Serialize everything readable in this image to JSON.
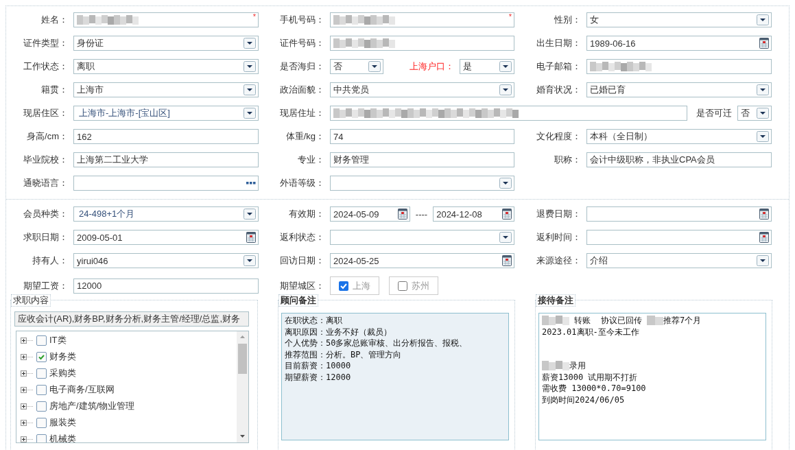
{
  "sections": [
    {
      "rows": [
        [
          {
            "kind": "single",
            "label": "姓名：",
            "fields": [
              {
                "kind": "text",
                "redacted": true,
                "mark": "*"
              }
            ]
          },
          {
            "kind": "single",
            "label": "手机号码：",
            "fields": [
              {
                "kind": "text",
                "redacted": true,
                "mark": "*"
              }
            ]
          },
          {
            "kind": "single",
            "label": "性别：",
            "fields": [
              {
                "kind": "select",
                "value": "女"
              }
            ]
          }
        ],
        [
          {
            "kind": "single",
            "label": "证件类型：",
            "fields": [
              {
                "kind": "select",
                "value": "身份证"
              }
            ]
          },
          {
            "kind": "single",
            "label": "证件号码：",
            "fields": [
              {
                "kind": "text",
                "redacted": true
              }
            ]
          },
          {
            "kind": "single",
            "label": "出生日期：",
            "fields": [
              {
                "kind": "date",
                "value": "1989-06-16"
              }
            ]
          }
        ],
        [
          {
            "kind": "single",
            "label": "工作状态：",
            "fields": [
              {
                "kind": "select",
                "value": "离职"
              }
            ]
          },
          {
            "kind": "pair",
            "label": "是否海归：",
            "extra_label": "上海户口：",
            "highlight": true,
            "fields": [
              {
                "kind": "select",
                "value": "否"
              },
              {
                "kind": "select",
                "value": "是"
              }
            ]
          },
          {
            "kind": "single",
            "label": "电子邮箱：",
            "fields": [
              {
                "kind": "text",
                "redacted": true
              }
            ]
          }
        ],
        [
          {
            "kind": "single",
            "label": "籍贯：",
            "fields": [
              {
                "kind": "select",
                "value": "上海市"
              }
            ]
          },
          {
            "kind": "single",
            "label": "政治面貌：",
            "fields": [
              {
                "kind": "select",
                "value": "中共党员"
              }
            ]
          },
          {
            "kind": "single",
            "label": "婚育状况：",
            "fields": [
              {
                "kind": "select",
                "value": "已婚已育"
              }
            ]
          }
        ],
        [
          {
            "kind": "single",
            "label": "现居住区：",
            "fields": [
              {
                "kind": "select",
                "value": "上海市-上海市-[宝山区]",
                "linked": true
              }
            ]
          },
          {
            "kind": "wide",
            "label": "现居住址：",
            "extra_label": "是否可迁",
            "highlight": false,
            "fields": [
              {
                "kind": "text",
                "redacted": true
              },
              {
                "kind": "select",
                "value": "否"
              }
            ]
          }
        ],
        [
          {
            "kind": "single",
            "label": "身高/cm：",
            "fields": [
              {
                "kind": "text",
                "value": "162"
              }
            ]
          },
          {
            "kind": "single",
            "label": "体重/kg：",
            "fields": [
              {
                "kind": "text",
                "value": "74"
              }
            ]
          },
          {
            "kind": "single",
            "label": "文化程度：",
            "fields": [
              {
                "kind": "select",
                "value": "本科（全日制）"
              }
            ]
          }
        ],
        [
          {
            "kind": "single",
            "label": "毕业院校：",
            "fields": [
              {
                "kind": "text",
                "value": "上海第二工业大学"
              }
            ]
          },
          {
            "kind": "single",
            "label": "专业：",
            "fields": [
              {
                "kind": "text",
                "value": "财务管理"
              }
            ]
          },
          {
            "kind": "single",
            "label": "职称：",
            "fields": [
              {
                "kind": "text",
                "value": "会计中级职称，非执业CPA会员"
              }
            ]
          }
        ],
        [
          {
            "kind": "single",
            "label": "通晓语言：",
            "fields": [
              {
                "kind": "lookup"
              }
            ]
          },
          {
            "kind": "single",
            "label": "外语等级：",
            "fields": [
              {
                "kind": "select"
              }
            ]
          }
        ]
      ]
    },
    {
      "rows": [
        [
          {
            "kind": "single",
            "label": "会员种类：",
            "fields": [
              {
                "kind": "select",
                "value": "24-498+1个月",
                "linked": true
              }
            ]
          },
          {
            "kind": "range",
            "label": "有效期：",
            "separator": "----",
            "fields": [
              {
                "kind": "date",
                "value": "2024-05-09"
              },
              {
                "kind": "date",
                "value": "2024-12-08"
              }
            ]
          },
          {
            "kind": "single",
            "label": "退费日期：",
            "fields": [
              {
                "kind": "date"
              }
            ]
          }
        ],
        [
          {
            "kind": "single",
            "label": "求职日期：",
            "fields": [
              {
                "kind": "date",
                "value": "2009-05-01"
              }
            ]
          },
          {
            "kind": "single",
            "label": "返利状态：",
            "fields": [
              {
                "kind": "select"
              }
            ]
          },
          {
            "kind": "single",
            "label": "返利时间：",
            "fields": [
              {
                "kind": "date"
              }
            ]
          }
        ],
        [
          {
            "kind": "single",
            "label": "持有人：",
            "fields": [
              {
                "kind": "select",
                "value": "yirui046"
              }
            ]
          },
          {
            "kind": "single",
            "label": "回访日期：",
            "fields": [
              {
                "kind": "date",
                "value": "2024-05-25"
              }
            ]
          },
          {
            "kind": "single",
            "label": "来源途径：",
            "fields": [
              {
                "kind": "select",
                "value": "介绍"
              }
            ]
          }
        ],
        [
          {
            "kind": "single",
            "label": "期望工资：",
            "fields": [
              {
                "kind": "text",
                "value": "12000"
              }
            ]
          },
          {
            "kind": "checks",
            "label": "期望城区：",
            "options": [
              {
                "label": "上海",
                "checked": true
              },
              {
                "label": "苏州",
                "checked": false
              }
            ]
          }
        ]
      ]
    }
  ],
  "groups": [
    {
      "kind": "tree",
      "title": "求职内容",
      "summary": "应收会计(AR),财务BP,财务分析,财务主管/经理/总监,财务",
      "items": [
        {
          "label": "IT类",
          "checked": false,
          "expanded": false
        },
        {
          "label": "财务类",
          "checked": true,
          "expanded": false
        },
        {
          "label": "采购类",
          "checked": false,
          "expanded": false
        },
        {
          "label": "电子商务/互联网",
          "checked": false,
          "expanded": false
        },
        {
          "label": "房地产/建筑/物业管理",
          "checked": false,
          "expanded": false
        },
        {
          "label": "服装类",
          "checked": false,
          "expanded": false
        },
        {
          "label": "机械类",
          "checked": false,
          "expanded": false
        }
      ]
    },
    {
      "kind": "notes",
      "title": "顾问备注",
      "tinted": true,
      "lines": [
        {
          "parts": [
            {
              "text": "在职状态：离职"
            }
          ]
        },
        {
          "parts": [
            {
              "text": "离职原因：业务不好（裁员）"
            }
          ]
        },
        {
          "parts": [
            {
              "text": "个人优势：50多家总账审核、出分析报告、报税、"
            }
          ]
        },
        {
          "parts": [
            {
              "text": "推荐范围：分析。BP、管理方向"
            }
          ]
        },
        {
          "parts": [
            {
              "text": "目前薪资：10000"
            }
          ]
        },
        {
          "parts": [
            {
              "text": "期望薪资：12000"
            }
          ]
        }
      ]
    },
    {
      "kind": "notes",
      "title": "接待备注",
      "tinted": false,
      "lines": [
        {
          "parts": [
            {
              "redacted": true
            },
            {
              "text": " 转账  协议已回传 "
            },
            {
              "redacted": true
            },
            {
              "text": "推荐7个月"
            }
          ]
        },
        {
          "parts": [
            {
              "text": "2023.01离职-至今未工作"
            }
          ]
        },
        {
          "space_before": true,
          "parts": [
            {
              "redacted": true
            },
            {
              "text": "录用"
            }
          ]
        },
        {
          "parts": [
            {
              "text": "薪资13000 试用期不打折"
            }
          ]
        },
        {
          "parts": [
            {
              "text": "需收费 13000*0.70=9100"
            }
          ]
        },
        {
          "parts": [
            {
              "text": "到岗时间2024/06/05"
            }
          ]
        }
      ]
    }
  ]
}
